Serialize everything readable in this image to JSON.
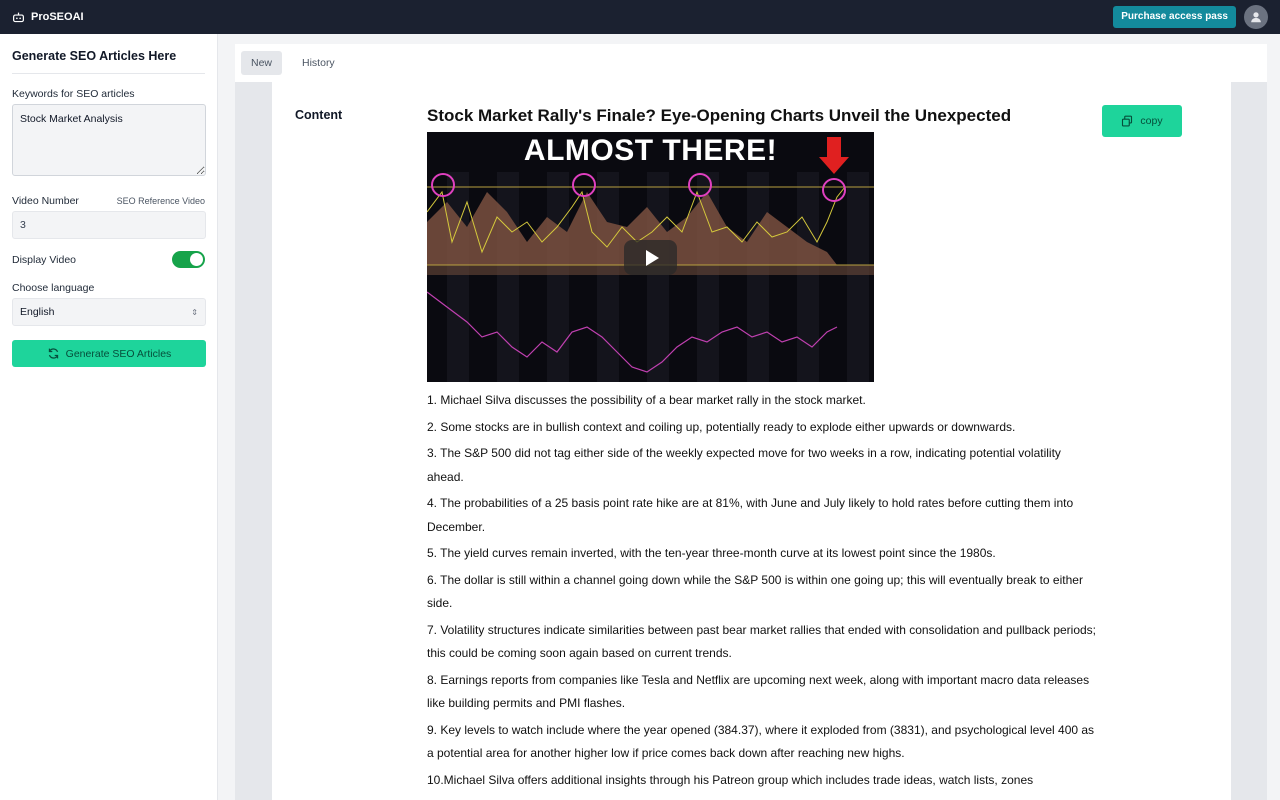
{
  "app": {
    "brand": "ProSEOAI"
  },
  "topbar": {
    "purchase_label": "Purchase access pass"
  },
  "sidebar": {
    "title": "Generate SEO Articles Here",
    "keywords_label": "Keywords for SEO articles",
    "keywords_value": "Stock Market Analysis",
    "video_number_label": "Video Number",
    "seo_reference_label": "SEO Reference Video",
    "video_number_value": "3",
    "display_video_label": "Display Video",
    "display_video_on": true,
    "language_label": "Choose language",
    "language_value": "English",
    "generate_label": "Generate SEO Articles"
  },
  "tabs": [
    {
      "label": "New",
      "active": true
    },
    {
      "label": "History",
      "active": false
    }
  ],
  "content": {
    "label": "Content",
    "copy_label": "copy",
    "title": "Stock Market Rally's Finale? Eye-Opening Charts Unveil the Unexpected",
    "video_overlay_text": "ALMOST THERE!",
    "paragraphs": [
      "1. Michael Silva discusses the possibility of a bear market rally in the stock market.",
      "2. Some stocks are in bullish context and coiling up, potentially ready to explode either upwards or downwards.",
      "3. The S&P 500 did not tag either side of the weekly expected move for two weeks in a row, indicating potential volatility ahead.",
      "4. The probabilities of a 25 basis point rate hike are at 81%, with June and July likely to hold rates before cutting them into December.",
      "5. The yield curves remain inverted, with the ten-year three-month curve at its lowest point since the 1980s.",
      "6. The dollar is still within a channel going down while the S&P 500 is within one going up; this will eventually break to either side.",
      "7. Volatility structures indicate similarities between past bear market rallies that ended with consolidation and pullback periods; this could be coming soon again based on current trends.",
      "8. Earnings reports from companies like Tesla and Netflix are upcoming next week, along with important macro data releases like building permits and PMI flashes.",
      "9. Key levels to watch include where the year opened (384.37), where it exploded from (3831), and psychological level 400 as a potential area for another higher low if price comes back down after reaching new highs.",
      "10.Michael Silva offers additional insights through his Patreon group which includes trade ideas, watch lists, zones"
    ]
  },
  "colors": {
    "topbar_bg": "#1b2130",
    "accent_green": "#1ed49b",
    "purchase_bg": "#138a9c",
    "toggle_on": "#16a34a"
  }
}
